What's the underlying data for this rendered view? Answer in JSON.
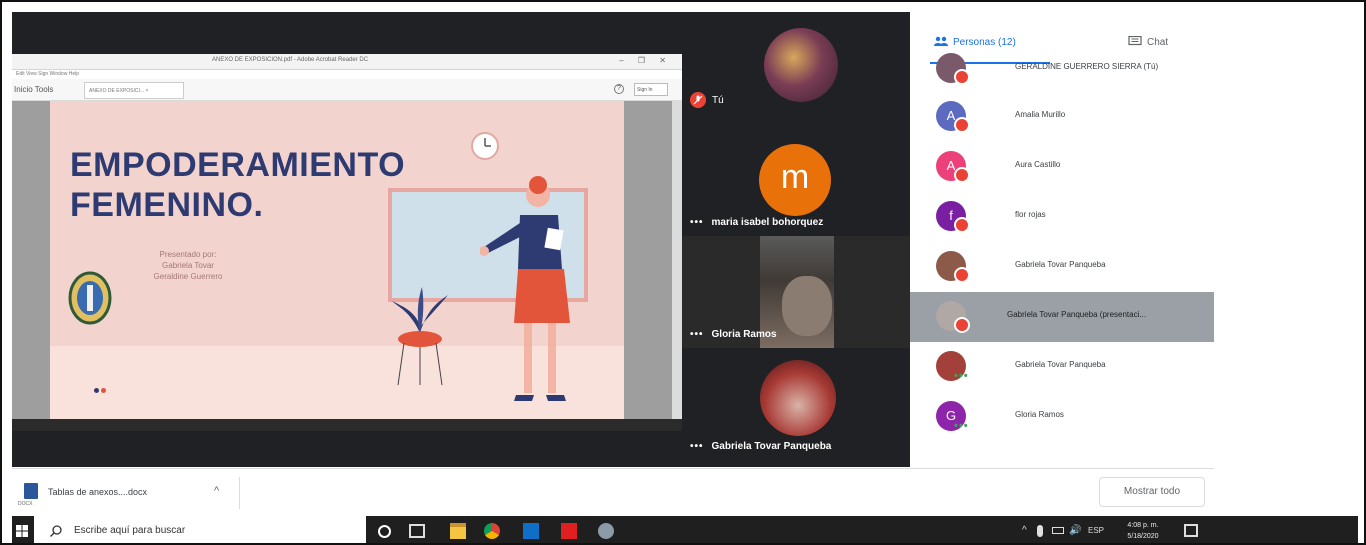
{
  "pdf_reader": {
    "window_title": "ANEXO DE EXPOSICION.pdf - Adobe Acrobat Reader DC",
    "window_controls": "– ❐ ✕",
    "menu": "Edit  View  Sign  Window  Help",
    "toolbar_label": "Inicio  Tools",
    "doc_tab": "ANEXO DE EXPOSICI... ×",
    "help_icon": "?",
    "signin": "Sign In"
  },
  "slide": {
    "title": "EMPODERAMIENTO\nFEMENINO.",
    "credits": "Presentado por:\nGabriela Tovar\nGeraldine Guerrero",
    "colors": {
      "background": "#f2d3cd",
      "title": "#2e3b72",
      "accent": "#e2553b"
    }
  },
  "participants_tiles": {
    "you": {
      "label": "Tú",
      "mic_muted": true
    },
    "maria": {
      "initial": "m",
      "label": "maria isabel bohorquez",
      "avatar_color": "#e8710a"
    },
    "gloria": {
      "label": "Gloria Ramos"
    },
    "gabriela": {
      "label": "Gabriela Tovar Panqueba"
    },
    "more_icon": "•••"
  },
  "panel": {
    "tabs": {
      "people": "Personas (12)",
      "chat": "Chat"
    },
    "accent_color": "#1a73e8",
    "people": [
      {
        "name": "GERALDINE GUERRERO SIERRA (Tú)",
        "avatar": "",
        "avatar_color": "#7a5a6a",
        "status": "muted"
      },
      {
        "name": "Amalia Murillo",
        "avatar": "A",
        "avatar_color": "#5c6bc0",
        "status": "muted"
      },
      {
        "name": "Aura Castillo",
        "avatar": "A",
        "avatar_color": "#ec407a",
        "status": "muted"
      },
      {
        "name": "flor rojas",
        "avatar": "f",
        "avatar_color": "#7b1fa2",
        "status": "muted"
      },
      {
        "name": "Gabriela Tovar Panqueba",
        "avatar": "",
        "avatar_color": "#8d5a4a",
        "status": "muted"
      },
      {
        "name": "Gabriela Tovar Panqueba (presentaci...",
        "avatar": "",
        "avatar_color": "#b0a8a4",
        "status": "presenting"
      },
      {
        "name": "Gabriela Tovar Panqueba",
        "avatar": "",
        "avatar_color": "#a3403a",
        "status": "more"
      },
      {
        "name": "Gloria Ramos",
        "avatar": "G",
        "avatar_color": "#8e24aa",
        "status": "more"
      }
    ]
  },
  "downloads": {
    "file_name": "Tablas de anexos....docx",
    "file_tag": "DOCX",
    "chevron": "^",
    "show_all": "Mostrar todo"
  },
  "taskbar": {
    "search_placeholder": "Escribe aquí para buscar",
    "tray_chevron": "^",
    "volume": "🔊",
    "language": "ESP",
    "time": "4:08 p. m.",
    "date": "5/18/2020"
  }
}
